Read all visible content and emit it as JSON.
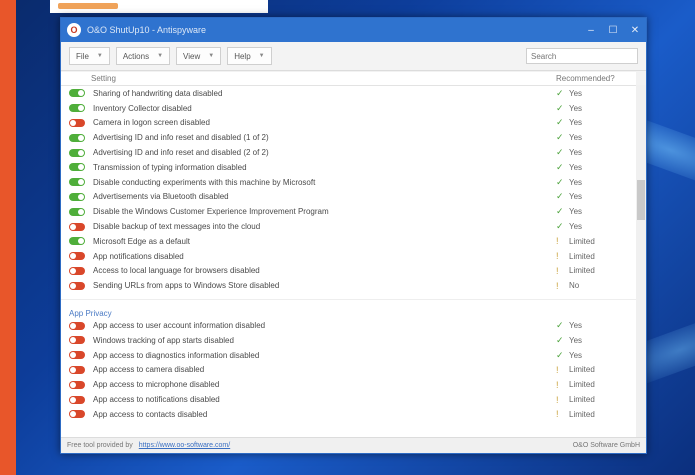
{
  "window": {
    "title": "O&O ShutUp10 - Antispyware",
    "app_icon_glyph": "O"
  },
  "toolbar": {
    "menus": [
      {
        "label": "File"
      },
      {
        "label": "Actions"
      },
      {
        "label": "View"
      },
      {
        "label": "Help"
      }
    ],
    "search_placeholder": "Search"
  },
  "columns": {
    "setting": "Setting",
    "recommended": "Recommended?"
  },
  "settings": [
    {
      "label": "Sharing of handwriting data disabled",
      "on": true,
      "rec": "Yes",
      "mark": "check"
    },
    {
      "label": "Inventory Collector disabled",
      "on": true,
      "rec": "Yes",
      "mark": "check"
    },
    {
      "label": "Camera in logon screen disabled",
      "on": false,
      "rec": "Yes",
      "mark": "check"
    },
    {
      "label": "Advertising ID and info reset and disabled (1 of 2)",
      "on": true,
      "rec": "Yes",
      "mark": "check"
    },
    {
      "label": "Advertising ID and info reset and disabled (2 of 2)",
      "on": true,
      "rec": "Yes",
      "mark": "check"
    },
    {
      "label": "Transmission of typing information disabled",
      "on": true,
      "rec": "Yes",
      "mark": "check"
    },
    {
      "label": "Disable conducting experiments with this machine by Microsoft",
      "on": true,
      "rec": "Yes",
      "mark": "check"
    },
    {
      "label": "Advertisements via Bluetooth disabled",
      "on": true,
      "rec": "Yes",
      "mark": "check"
    },
    {
      "label": "Disable the Windows Customer Experience Improvement Program",
      "on": true,
      "rec": "Yes",
      "mark": "check"
    },
    {
      "label": "Disable backup of text messages into the cloud",
      "on": false,
      "rec": "Yes",
      "mark": "check"
    },
    {
      "label": "Microsoft Edge as a default",
      "on": true,
      "rec": "Limited",
      "mark": "warn"
    },
    {
      "label": "App notifications disabled",
      "on": false,
      "rec": "Limited",
      "mark": "warn"
    },
    {
      "label": "Access to local language for browsers disabled",
      "on": false,
      "rec": "Limited",
      "mark": "warn"
    },
    {
      "label": "Sending URLs from apps to Windows Store disabled",
      "on": false,
      "rec": "No",
      "mark": "warn"
    }
  ],
  "group_title": "App Privacy",
  "app_privacy": [
    {
      "label": "App access to user account information disabled",
      "on": false,
      "rec": "Yes",
      "mark": "check"
    },
    {
      "label": "Windows tracking of app starts disabled",
      "on": false,
      "rec": "Yes",
      "mark": "check"
    },
    {
      "label": "App access to diagnostics information disabled",
      "on": false,
      "rec": "Yes",
      "mark": "check"
    },
    {
      "label": "App access to camera disabled",
      "on": false,
      "rec": "Limited",
      "mark": "warn"
    },
    {
      "label": "App access to microphone disabled",
      "on": false,
      "rec": "Limited",
      "mark": "warn"
    },
    {
      "label": "App access to notifications disabled",
      "on": false,
      "rec": "Limited",
      "mark": "warn"
    },
    {
      "label": "App access to contacts disabled",
      "on": false,
      "rec": "Limited",
      "mark": "warn"
    }
  ],
  "status": {
    "text": "Free tool provided by",
    "link": "https://www.oo-software.com/",
    "right": "O&O Software GmbH"
  },
  "icons": {
    "check": "✓",
    "warn": "!"
  }
}
